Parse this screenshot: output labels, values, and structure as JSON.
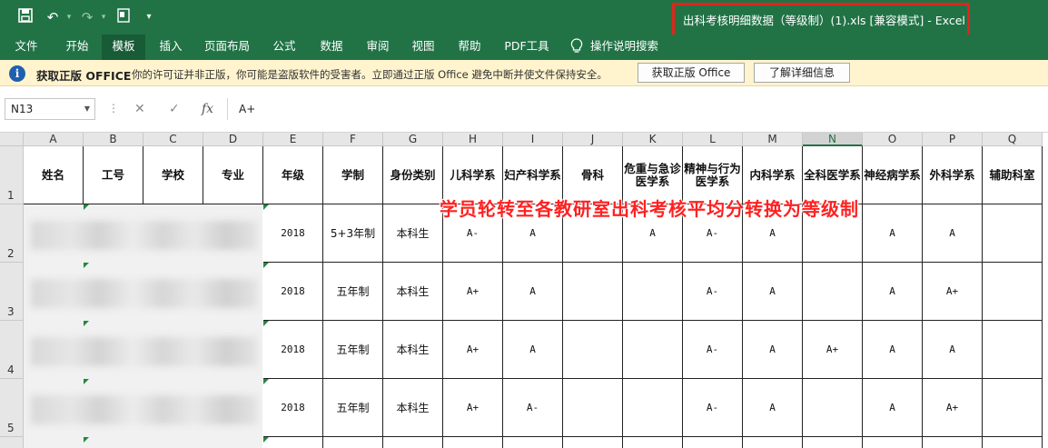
{
  "window": {
    "title": "出科考核明细数据（等级制）(1).xls  [兼容模式]  -  Excel"
  },
  "quick_access": {
    "save_icon": "save-icon",
    "undo_icon": "undo-icon",
    "redo_icon": "redo-icon",
    "customize_icon": "customize-icon"
  },
  "ribbon_tabs": [
    "文件",
    "开始",
    "模板",
    "插入",
    "页面布局",
    "公式",
    "数据",
    "审阅",
    "视图",
    "帮助",
    "PDF工具"
  ],
  "ribbon_active_tab": "模板",
  "tell_me": "操作说明搜索",
  "message_bar": {
    "title": "获取正版 OFFICE",
    "body": "你的许可证并非正版，你可能是盗版软件的受害者。立即通过正版 Office 避免中断并使文件保持安全。",
    "button_get": "获取正版 Office",
    "button_learn": "了解详细信息"
  },
  "formula_bar": {
    "name_box": "N13",
    "formula": "A+",
    "fx_label": "fx"
  },
  "sheet": {
    "columns": [
      "A",
      "B",
      "C",
      "D",
      "E",
      "F",
      "G",
      "H",
      "I",
      "J",
      "K",
      "L",
      "M",
      "N",
      "O",
      "P",
      "Q"
    ],
    "selected_column": "N",
    "row_numbers": [
      "1",
      "2",
      "3",
      "4",
      "5"
    ],
    "headers": [
      "姓名",
      "工号",
      "学校",
      "专业",
      "年级",
      "学制",
      "身份类别",
      "儿科学系",
      "妇产科学系",
      "骨科",
      "危重与急诊医学系",
      "精神与行为医学系",
      "内科学系",
      "全科医学系",
      "神经病学系",
      "外科学系",
      "辅助科室"
    ],
    "rows": [
      {
        "grade": "2018",
        "system": "5+3年制",
        "identity": "本科生",
        "H": "A-",
        "I": "A",
        "J": "",
        "K": "A",
        "L": "A-",
        "M": "A",
        "N": "",
        "O": "A",
        "P": "A",
        "Q": ""
      },
      {
        "grade": "2018",
        "system": "五年制",
        "identity": "本科生",
        "H": "A+",
        "I": "A",
        "J": "",
        "K": "",
        "L": "A-",
        "M": "A",
        "N": "",
        "O": "A",
        "P": "A+",
        "Q": ""
      },
      {
        "grade": "2018",
        "system": "五年制",
        "identity": "本科生",
        "H": "A+",
        "I": "A",
        "J": "",
        "K": "",
        "L": "A-",
        "M": "A",
        "N": "A+",
        "O": "A",
        "P": "A",
        "Q": ""
      },
      {
        "grade": "2018",
        "system": "五年制",
        "identity": "本科生",
        "H": "A+",
        "I": "A-",
        "J": "",
        "K": "",
        "L": "A-",
        "M": "A",
        "N": "",
        "O": "A",
        "P": "A+",
        "Q": ""
      }
    ]
  },
  "annotation": "学员轮转至各教研室出科考核平均分转换为等级制",
  "colors": {
    "excel_green": "#217346",
    "annotation_red": "#ff2121",
    "highlight_box": "#e0251b",
    "message_bar": "#fff4ce"
  }
}
